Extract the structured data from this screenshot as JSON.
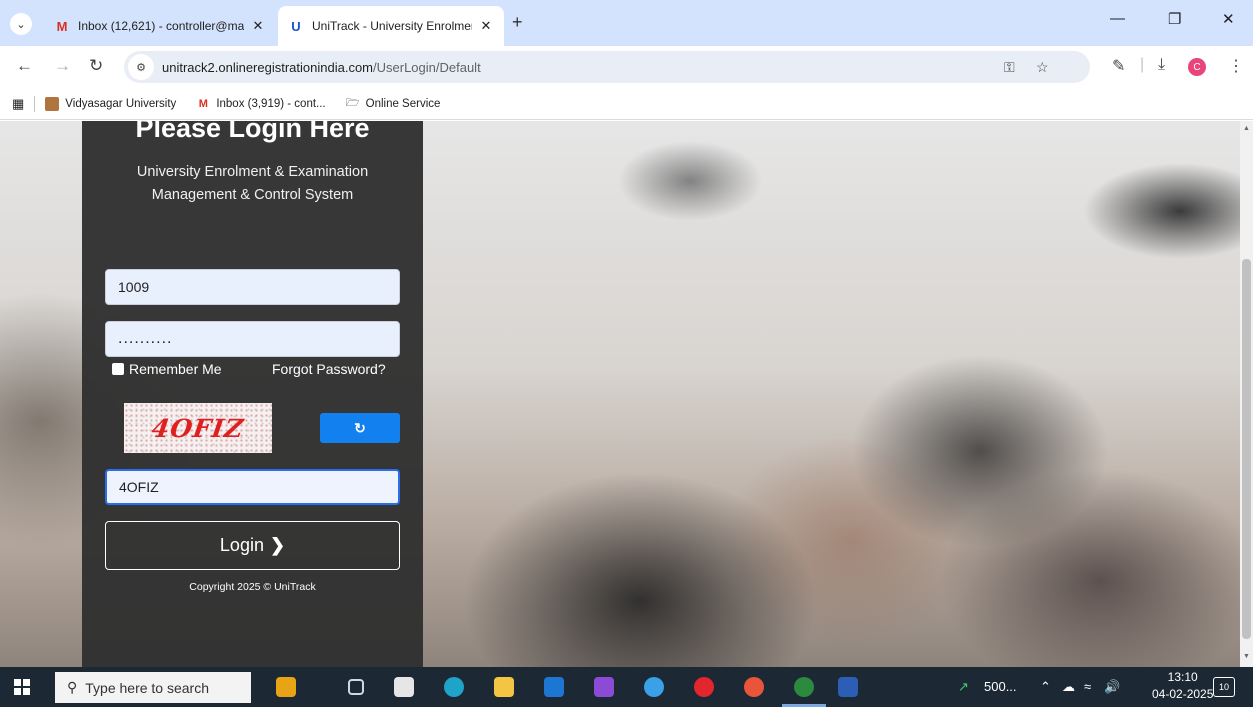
{
  "browser": {
    "tabs": [
      {
        "title": "Inbox (12,621) - controller@ma",
        "favicon": "gmail-icon",
        "active": false
      },
      {
        "title": "UniTrack - University Enrolment",
        "favicon": "unitrack-icon",
        "active": true
      }
    ],
    "new_tab": "+",
    "address_bar": {
      "domain": "unitrack2.onlineregistrationindia.com",
      "path": "/UserLogin/Default"
    },
    "profile_initial": "C",
    "bookmarks": [
      {
        "label": "Vidyasagar University",
        "icon": "university-icon"
      },
      {
        "label": "Inbox (3,919) - cont...",
        "icon": "gmail-icon"
      },
      {
        "label": "Online Service",
        "icon": "folder-icon"
      }
    ]
  },
  "login_panel": {
    "title": "Please Login Here",
    "subtitle_line1": "University Enrolment & Examination",
    "subtitle_line2": "Management & Control System",
    "username_value": "1009",
    "password_value": "..........",
    "remember_label": "Remember Me",
    "forgot_label": "Forgot Password?",
    "captcha_text": "4OFIZ",
    "captcha_input_value": "4OFIZ",
    "login_label": "Login",
    "copyright": "Copyright 2025 © UniTrack"
  },
  "taskbar": {
    "search_placeholder": "Type here to search",
    "stock_label": "500...",
    "time": "13:10",
    "date": "04-02-2025",
    "notification_count": "10"
  },
  "colors": {
    "tabstrip": "#d3e3fd",
    "panel": "#303030",
    "refresh_button": "#1380f0",
    "taskbar": "#1c2833"
  }
}
